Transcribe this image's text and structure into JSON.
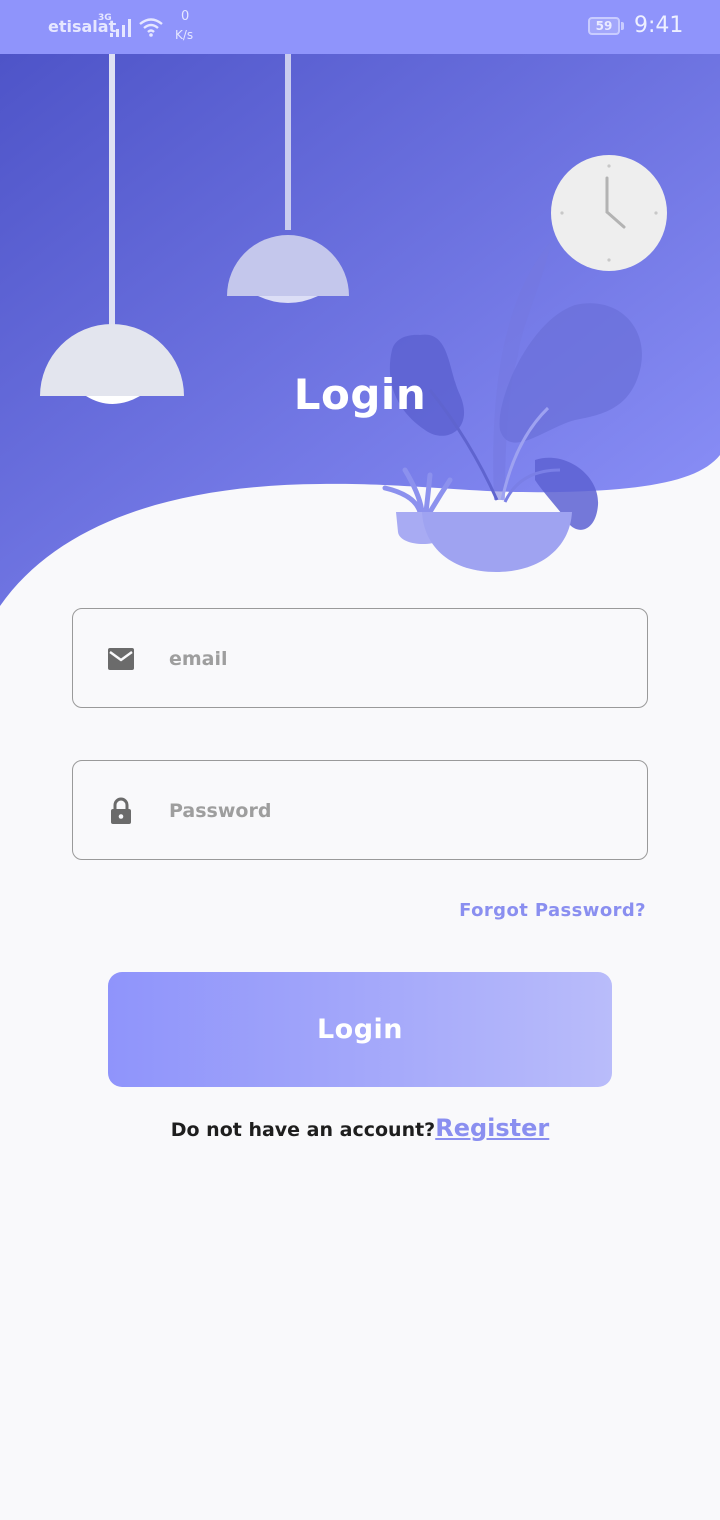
{
  "status_bar": {
    "carrier": "etisalat",
    "network_type": "3G",
    "speed_value": "0",
    "speed_unit": "K/s",
    "battery": "59",
    "time": "9:41",
    "icons": [
      "signal-icon",
      "wifi-icon",
      "battery-icon"
    ]
  },
  "header": {
    "title": "Login"
  },
  "form": {
    "email": {
      "placeholder": "email",
      "value": "",
      "icon": "mail-icon"
    },
    "password": {
      "placeholder": "Password",
      "value": "",
      "icon": "lock-icon"
    },
    "forgot_label": "Forgot Password?",
    "login_label": "Login",
    "no_account_text": "Do not have an account?",
    "register_label": "Register"
  },
  "colors": {
    "accent": "#8f94fb",
    "gradient_start": "#4e54c8",
    "gradient_end": "#8f94fb",
    "link": "#8a8ff0",
    "background": "#f9f9fb"
  }
}
